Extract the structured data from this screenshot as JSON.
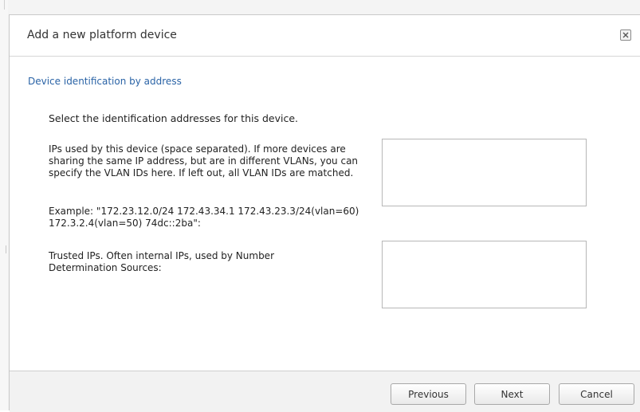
{
  "dialog": {
    "title": "Add a new platform device",
    "close_icon": "close-icon"
  },
  "section": {
    "title": "Device identification by address"
  },
  "intro": "Select the identification addresses for this device.",
  "ips_field": {
    "description": "IPs used by this device (space separated). If more devices are sharing the same IP address, but are in different VLANs, you can specify the VLAN IDs here. If left out, all VLAN IDs are matched.",
    "example": "Example: \"172.23.12.0/24 172.43.34.1 172.43.23.3/24(vlan=60) 172.3.2.4(vlan=50) 74dc::2ba\":",
    "value": ""
  },
  "trusted_ips_field": {
    "description": "Trusted IPs. Often internal IPs, used by Number Determination Sources:",
    "value": ""
  },
  "footer": {
    "previous_label": "Previous",
    "next_label": "Next",
    "cancel_label": "Cancel"
  }
}
